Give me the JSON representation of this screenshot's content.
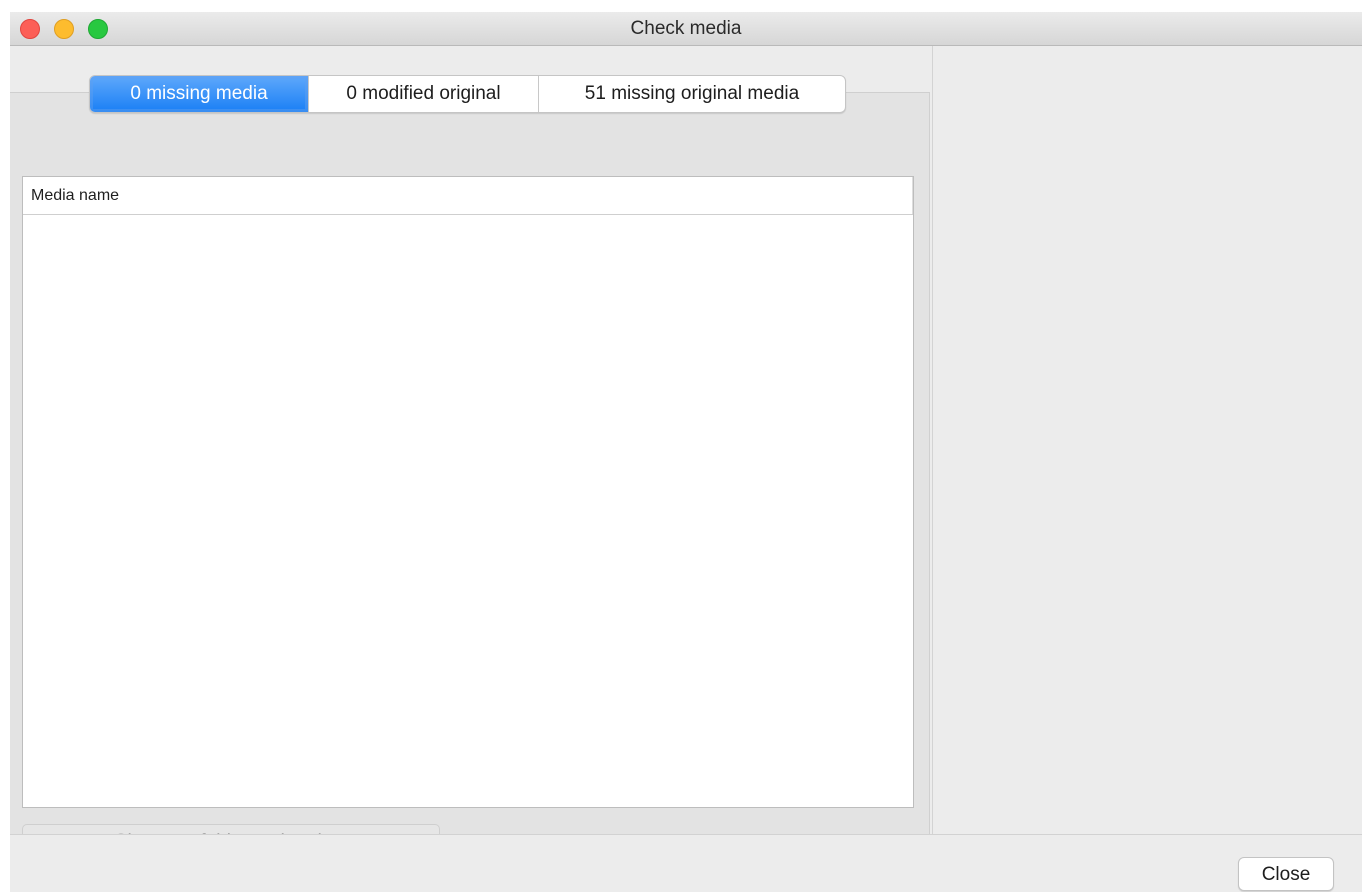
{
  "window": {
    "title": "Check media"
  },
  "tabs": [
    {
      "label": "0 missing media",
      "selected": true
    },
    {
      "label": "0 modified original",
      "selected": false
    },
    {
      "label": "51 missing original media",
      "selected": false
    }
  ],
  "table": {
    "columns": [
      "Media name"
    ],
    "rows": []
  },
  "buttons": {
    "choose_folder_label": "Choose a folder and update",
    "close_label": "Close"
  },
  "colors": {
    "accent": "#1a7ff5",
    "close": "#fc5f57",
    "minimize": "#fdbc2e",
    "maximize": "#28c840"
  }
}
